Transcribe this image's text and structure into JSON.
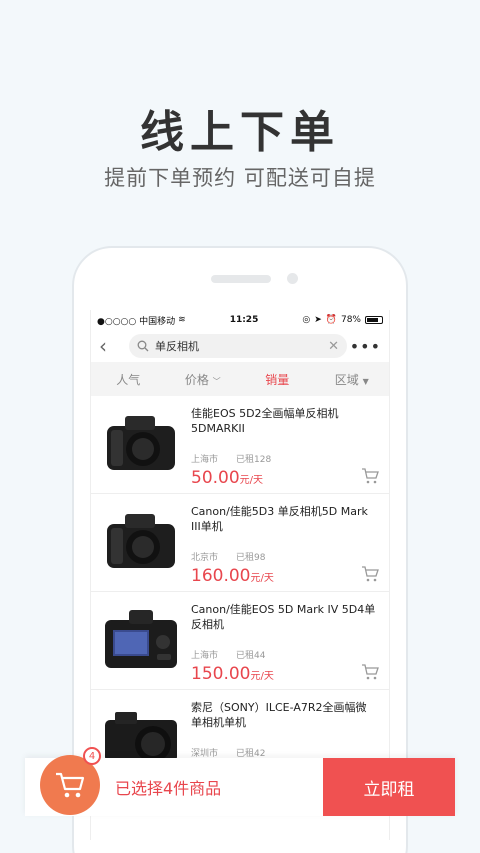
{
  "hero": {
    "title": "线上下单",
    "subtitle": "提前下单预约 可配送可自提"
  },
  "status_bar": {
    "carrier": "●○○○○ 中国移动",
    "time": "11:25",
    "battery": "78%",
    "battery_level": 0.78
  },
  "search": {
    "query": "单反相机"
  },
  "filters": [
    {
      "label": "人气",
      "active": false
    },
    {
      "label": "价格",
      "active": false
    },
    {
      "label": "销量",
      "active": true
    },
    {
      "label": "区域",
      "active": false
    }
  ],
  "products": [
    {
      "title": "佳能EOS 5D2全画幅单反相机 5DMARKII",
      "city": "上海市",
      "rented": "已租128",
      "price": "50.00",
      "unit": "元/天"
    },
    {
      "title": "Canon/佳能5D3 单反相机5D Mark III单机",
      "city": "北京市",
      "rented": "已租98",
      "price": "160.00",
      "unit": "元/天"
    },
    {
      "title": "Canon/佳能EOS 5D Mark IV 5D4单反相机",
      "city": "上海市",
      "rented": "已租44",
      "price": "150.00",
      "unit": "元/天"
    },
    {
      "title": "索尼（SONY）ILCE-A7R2全画幅微单相机单机",
      "city": "深圳市",
      "rented": "已租42",
      "price": "",
      "unit": ""
    }
  ],
  "cart": {
    "count": "4",
    "selected_text": "已选择4件商品",
    "rent_label": "立即租"
  },
  "colors": {
    "accent": "#e8464d",
    "cart_orange": "#f07a4f"
  }
}
